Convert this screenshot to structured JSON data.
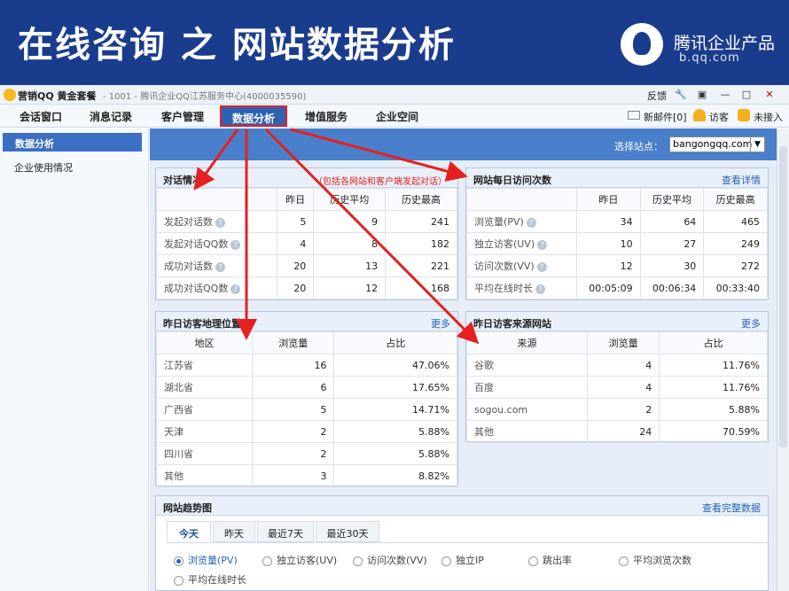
{
  "banner": {
    "title": "在线咨询 之 网站数据分析",
    "brand": "腾讯企业产品",
    "domain": "b.qq.com"
  },
  "window": {
    "app_title": "营销QQ 黄金套餐",
    "subtitle": "- 1001 - 腾讯企业QQ江苏服务中心(4000035590)",
    "feedback": "反馈"
  },
  "menu": {
    "tabs": [
      "会话窗口",
      "消息记录",
      "客户管理",
      "数据分析",
      "增值服务",
      "企业空间"
    ],
    "active": "数据分析",
    "mail": "新邮件[0]",
    "visitor": "访客",
    "unanswered": "未接入"
  },
  "sidebar": {
    "active": "数据分析",
    "items": [
      "企业使用情况"
    ]
  },
  "site": {
    "label": "选择站点：",
    "value": "bangongqq.com"
  },
  "dialog": {
    "title": "对话情况",
    "note": "（包括各网站和客户端发起对话）",
    "headers": [
      "",
      "昨日",
      "历史平均",
      "历史最高"
    ],
    "rows": [
      [
        "发起对话数",
        "5",
        "9",
        "241"
      ],
      [
        "发起对话QQ数",
        "4",
        "8",
        "182"
      ],
      [
        "成功对话数",
        "20",
        "13",
        "221"
      ],
      [
        "成功对话QQ数",
        "20",
        "12",
        "168"
      ]
    ]
  },
  "visits": {
    "title": "网站每日访问次数",
    "link": "查看详情",
    "headers": [
      "",
      "昨日",
      "历史平均",
      "历史最高"
    ],
    "rows": [
      [
        "浏览量(PV)",
        "34",
        "64",
        "465"
      ],
      [
        "独立访客(UV)",
        "10",
        "27",
        "249"
      ],
      [
        "访问次数(VV)",
        "12",
        "30",
        "272"
      ],
      [
        "平均在线时长",
        "00:05:09",
        "00:06:34",
        "00:33:40"
      ]
    ]
  },
  "geo": {
    "title": "昨日访客地理位置",
    "link": "更多",
    "headers": [
      "地区",
      "浏览量",
      "占比"
    ],
    "rows": [
      [
        "江苏省",
        "16",
        "47.06%"
      ],
      [
        "湖北省",
        "6",
        "17.65%"
      ],
      [
        "广西省",
        "5",
        "14.71%"
      ],
      [
        "天津",
        "2",
        "5.88%"
      ],
      [
        "四川省",
        "2",
        "5.88%"
      ],
      [
        "其他",
        "3",
        "8.82%"
      ]
    ]
  },
  "sources": {
    "title": "昨日访客来源网站",
    "link": "更多",
    "headers": [
      "来源",
      "浏览量",
      "占比"
    ],
    "rows": [
      [
        "谷歌",
        "4",
        "11.76%"
      ],
      [
        "百度",
        "4",
        "11.76%"
      ],
      [
        "sogou.com",
        "2",
        "5.88%"
      ],
      [
        "其他",
        "24",
        "70.59%"
      ]
    ]
  },
  "trend": {
    "title": "网站趋势图",
    "link": "查看完整数据",
    "tabs": [
      "今天",
      "昨天",
      "最近7天",
      "最近30天"
    ],
    "metrics": [
      "浏览量(PV)",
      "独立访客(UV)",
      "访问次数(VV)",
      "独立IP",
      "跳出率",
      "平均浏览次数",
      "平均在线时长"
    ],
    "selected": "浏览量(PV)"
  },
  "colors": {
    "banner": "#1a3c8d",
    "accent": "#2e62b3",
    "highlight": "#e52020"
  }
}
